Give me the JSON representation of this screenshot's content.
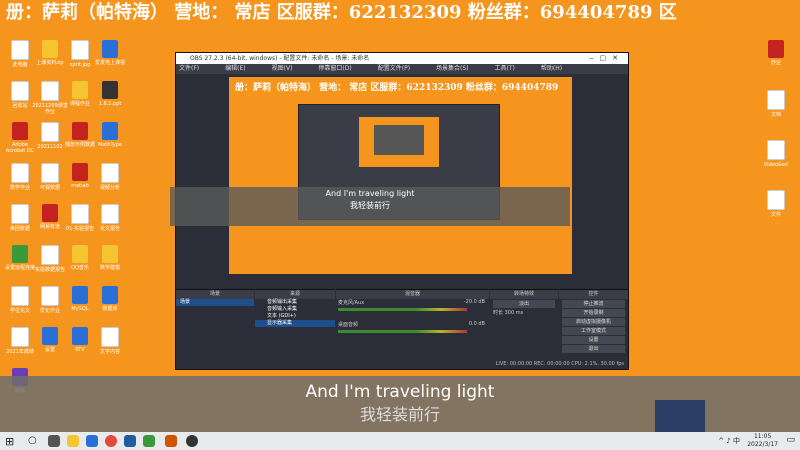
{
  "banner": {
    "text": "册：萨莉（帕特海） 营地：  常店 区服群：622132309   粉丝群：694404789 区"
  },
  "desktop_left": [
    {
      "label": "此电脑",
      "color": "doc"
    },
    {
      "label": "上课资料zip",
      "color": "yellow"
    },
    {
      "label": "sprit.jpg",
      "color": "doc"
    },
    {
      "label": "爱发电上课视",
      "color": "blue"
    },
    {
      "label": "回收站",
      "color": "doc"
    },
    {
      "label": "20211209课堂作业",
      "color": "doc"
    },
    {
      "label": "课程作业",
      "color": "yellow"
    },
    {
      "label": "1.8.1.ppt",
      "color": "dark"
    },
    {
      "label": "Adobe Acrobat DC",
      "color": "red"
    },
    {
      "label": "20211101",
      "color": "doc"
    },
    {
      "label": "播放示例数据",
      "color": "red"
    },
    {
      "label": "MathType",
      "color": "blue"
    },
    {
      "label": "数学作业",
      "color": "doc"
    },
    {
      "label": "可视数据",
      "color": "doc"
    },
    {
      "label": "matlab",
      "color": "red"
    },
    {
      "label": "视频分析",
      "color": "doc"
    },
    {
      "label": "美团数据",
      "color": "doc"
    },
    {
      "label": "网易有道",
      "color": "red"
    },
    {
      "label": "01-实验报告",
      "color": "doc"
    },
    {
      "label": "论文报告",
      "color": "doc"
    },
    {
      "label": "设置远程连接",
      "color": "green"
    },
    {
      "label": "实验数据报告",
      "color": "doc"
    },
    {
      "label": "QQ音乐",
      "color": "yellow"
    },
    {
      "label": "数学建模",
      "color": "yellow"
    },
    {
      "label": "学位论文",
      "color": "doc"
    },
    {
      "label": "优化作业",
      "color": "doc"
    },
    {
      "label": "MySQL",
      "color": "blue"
    },
    {
      "label": "数据库",
      "color": "blue"
    },
    {
      "label": "2021年成绩",
      "color": "doc"
    },
    {
      "label": "设置",
      "color": "blue"
    },
    {
      "label": "KTV",
      "color": "blue"
    },
    {
      "label": "文字内容",
      "color": "doc"
    },
    {
      "label": "模板",
      "color": "purple"
    }
  ],
  "desktop_right": [
    {
      "label": "作业",
      "color": "red"
    },
    {
      "label": "文档",
      "color": "doc"
    },
    {
      "label": "Video&ed",
      "color": "doc"
    },
    {
      "label": "文件",
      "color": "doc"
    }
  ],
  "obs": {
    "title": "OBS 27.2.3 (64-bit, windows) - 配置文件: 未命名 - 场景: 未命名",
    "menu": [
      "文件(F)",
      "编辑(E)",
      "视图(V)",
      "停靠窗口(D)",
      "配置文件(P)",
      "场景集合(S)",
      "工具(T)",
      "帮助(H)"
    ],
    "preview_banner": "册：萨莉（帕特海） 营地：  常店 区服群：622132309  粉丝群：694404789",
    "scene_panel_title": "场景",
    "source_panel_title": "来源",
    "mixer_panel_title": "混音器",
    "transition_panel_title": "转场特效",
    "control_panel_title": "控件",
    "scenes": [
      "场景"
    ],
    "sources": [
      "音频输出采集",
      "音频输入采集",
      "文本 (GDI+)",
      "显示器采集"
    ],
    "mixer": [
      {
        "name": "麦克风/Aux",
        "level": "-20.0 dB"
      },
      {
        "name": "桌面音频",
        "level": "0.0 dB"
      },
      {
        "name": "音频输入采集",
        "level": "0.0 dB"
      }
    ],
    "transition": {
      "type": "淡出",
      "duration_label": "时长",
      "duration": "300 ms"
    },
    "controls": [
      "停止推流",
      "开始录制",
      "启动虚拟摄像机",
      "工作室模式",
      "设置",
      "退出"
    ],
    "status": "LIVE: 00:00:00   REC: 00:00:00   CPU: 2.1%, 30.00 fps",
    "tabs": [
      "滤镜",
      "场景"
    ]
  },
  "subtitle_small": {
    "en": "And I'm traveling light",
    "zh": "我轻装前行"
  },
  "subtitle_big": {
    "en": "And I'm traveling light",
    "zh": "我轻装前行"
  },
  "taskbar": {
    "time": "11:05",
    "date": "2022/3/17",
    "tray": "^  ♪  中"
  }
}
